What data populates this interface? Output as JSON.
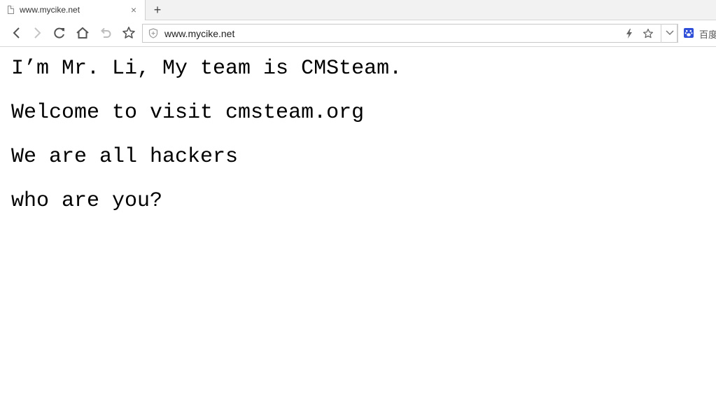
{
  "tab": {
    "title": "www.mycike.net",
    "close_glyph": "×",
    "icon": "page-icon"
  },
  "new_tab": {
    "glyph": "+"
  },
  "address_bar": {
    "url": "www.mycike.net",
    "security_icon": "shield-icon"
  },
  "search": {
    "engine_icon": "baidu-paw-icon",
    "label": "百度"
  },
  "page": {
    "lines": [
      "I’m Mr. Li, My team is CMSteam.",
      "Welcome to visit cmsteam.org",
      "We are all hackers",
      "who are you?"
    ]
  },
  "colors": {
    "tabbar_bg": "#f2f2f2",
    "baidu_blue": "#2f4fd8",
    "text": "#000000"
  }
}
